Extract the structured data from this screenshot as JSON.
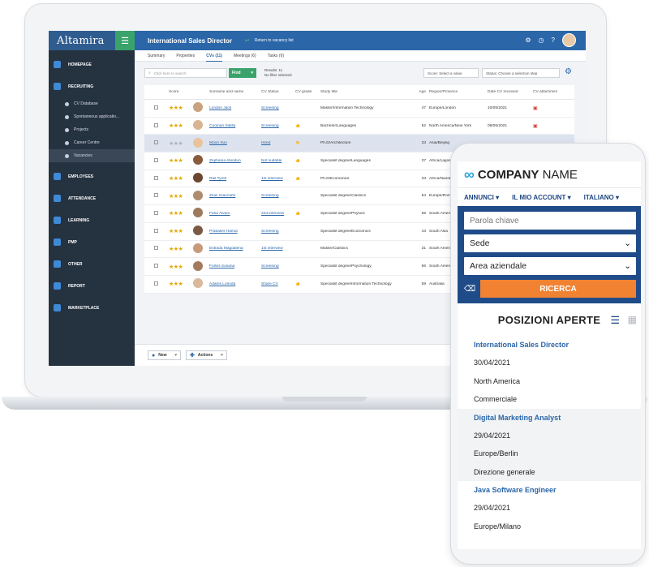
{
  "app": {
    "logo": "Altamira",
    "title": "International Sales Director",
    "back_label": "Return to vacancy list"
  },
  "sidebar": {
    "sections": [
      {
        "label": "HOMEPAGE",
        "icon": "home-icon"
      },
      {
        "label": "RECRUITING",
        "icon": "recruiting-icon",
        "items": [
          {
            "label": "CV Database",
            "icon": "database-icon"
          },
          {
            "label": "Spontaneous applicatio...",
            "icon": "document-icon"
          },
          {
            "label": "Projects",
            "icon": "projects-icon"
          },
          {
            "label": "Career Centre",
            "icon": "globe-icon"
          },
          {
            "label": "Vacancies",
            "icon": "search-icon"
          }
        ]
      },
      {
        "label": "EMPLOYEES",
        "icon": "employees-icon"
      },
      {
        "label": "ATTENDANCE",
        "icon": "attendance-icon"
      },
      {
        "label": "LEARNING",
        "icon": "learning-icon"
      },
      {
        "label": "PMP",
        "icon": "pmp-icon"
      },
      {
        "label": "OTHER",
        "icon": "other-icon"
      },
      {
        "label": "REPORT",
        "icon": "report-icon"
      },
      {
        "label": "MARKETPLACE",
        "icon": "marketplace-icon"
      }
    ]
  },
  "tabs": [
    {
      "label": "Summary"
    },
    {
      "label": "Properties"
    },
    {
      "label": "CVs (11)"
    },
    {
      "label": "Meetings (6)"
    },
    {
      "label": "Tasks (6)"
    }
  ],
  "toolbar": {
    "search_placeholder": "Click here to search",
    "find_label": "Find",
    "results_line1": "Results: 11",
    "results_line2": "No filter selected",
    "score_select": "Score: Select a value",
    "status_select": "Status: Choose a selection step"
  },
  "table": {
    "headers": {
      "score": "Score",
      "name": "Surname and name",
      "status": "CV Status",
      "grade": "CV grade",
      "study": "Study title",
      "age": "Age",
      "region": "Region/Province",
      "date": "Date CV received",
      "attachment": "CV attachment"
    },
    "rows": [
      {
        "name": "London Jack",
        "status": "Screening",
        "grade": "",
        "study": "Master/Information Technology",
        "age": "47",
        "region": "Europe/London",
        "date": "10/05/2021",
        "stars": 3
      },
      {
        "name": "Cooman Sibilla",
        "status": "Screening",
        "grade": "👍",
        "study": "Bachelor/Languages",
        "age": "52",
        "region": "North America/New York",
        "date": "09/05/2021",
        "stars": 3
      },
      {
        "name": "Moon Sun",
        "status": "Hired",
        "grade": "✋",
        "study": "Ph.D/Architecture",
        "age": "33",
        "region": "Asia/Beijing",
        "date": "",
        "stars": 0
      },
      {
        "name": "Zephania Abiodun",
        "status": "Not suitable",
        "grade": "👍",
        "study": "Specialist degree/Languages",
        "age": "37",
        "region": "Africa/Lagos",
        "date": "",
        "stars": 3
      },
      {
        "name": "Rail Tyrell",
        "status": "1st interview",
        "grade": "👍",
        "study": "Ph.D/Economics",
        "age": "33",
        "region": "Africa/Nairobi",
        "date": "",
        "stars": 3
      },
      {
        "name": "Zeuli Giancarlo",
        "status": "Screening",
        "grade": "",
        "study": "Specialist degree/Classics",
        "age": "64",
        "region": "Europe/Rome",
        "date": "",
        "stars": 3
      },
      {
        "name": "Faria Alvaro",
        "status": "2nd interview",
        "grade": "👍",
        "study": "Specialist degree/Physics",
        "age": "65",
        "region": "South America",
        "date": "",
        "stars": 3
      },
      {
        "name": "Prabaker Hamid",
        "status": "Screening",
        "grade": "",
        "study": "Specialist degree/Economics",
        "age": "43",
        "region": "South Asia",
        "date": "",
        "stars": 3
      },
      {
        "name": "Estrada Magdalena",
        "status": "1st interview",
        "grade": "",
        "study": "Master/Classics",
        "age": "31",
        "region": "South America",
        "date": "",
        "stars": 3
      },
      {
        "name": "Fortes Susana",
        "status": "Screening",
        "grade": "",
        "study": "Specialist degree/Psychology",
        "age": "56",
        "region": "South America",
        "date": "",
        "stars": 3
      },
      {
        "name": "Adams Lorinda",
        "status": "Share CV",
        "grade": "👍",
        "study": "Specialist degree/Information Technology",
        "age": "59",
        "region": "Australia",
        "date": "",
        "stars": 3
      }
    ]
  },
  "bottombar": {
    "new_label": "New",
    "actions_label": "Actions"
  },
  "phone": {
    "company_bold": "COMPANY",
    "company_light": " NAME",
    "nav": [
      "ANNUNCI ▾",
      "IL MIO ACCOUNT ▾",
      "ITALIANO ▾"
    ],
    "keyword_placeholder": "Parola chiave",
    "location_select": "Sede",
    "area_select": "Area aziendale",
    "search_label": "RICERCA",
    "positions_title": "POSIZIONI APERTE",
    "jobs": [
      {
        "title": "International Sales Director",
        "date": "30/04/2021",
        "location": "North America",
        "department": "Commerciale"
      },
      {
        "title": "Digital Marketing Analyst",
        "date": "29/04/2021",
        "location": "Europe/Berlin",
        "department": "Direzione generale"
      },
      {
        "title": "Java Software Engineer",
        "date": "29/04/2021",
        "location": "Europe/Milano",
        "department": ""
      }
    ]
  },
  "colors": {
    "brand_blue": "#2a66a8",
    "sidebar_bg": "#253240",
    "accent_green": "#3aa36b",
    "orange": "#f08232",
    "phone_form_bg": "#1f4c89"
  }
}
